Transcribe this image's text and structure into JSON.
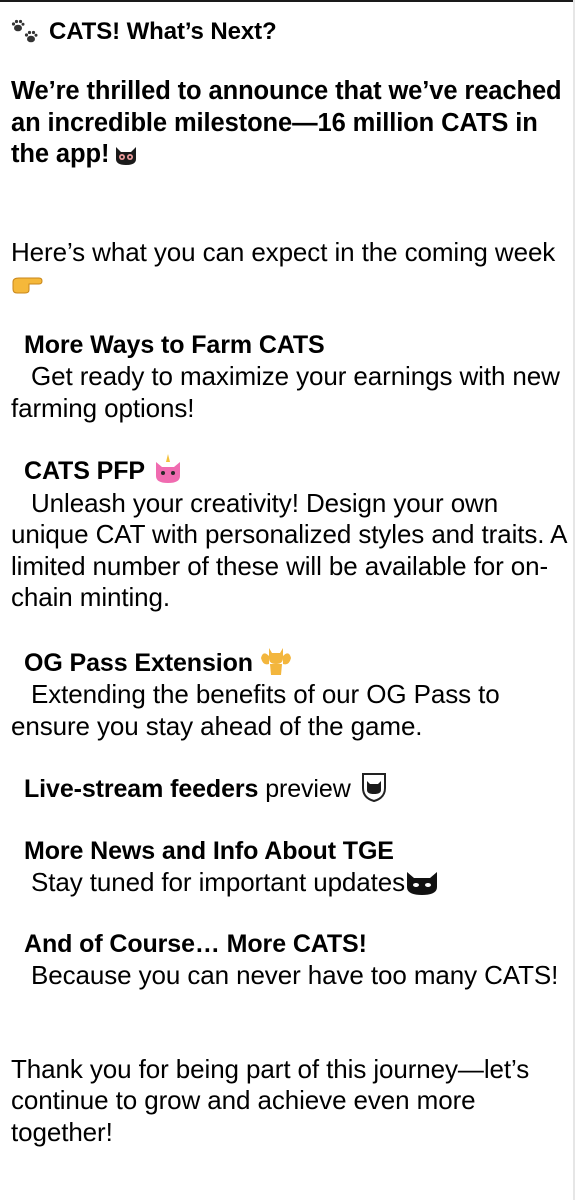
{
  "post": {
    "title": "CATS! What’s Next?",
    "announcement": "We’re thrilled to announce that we’ve reached an incredible milestone—16 million CATS in the app!",
    "intro": "Here’s what you can expect in the coming week",
    "sections": [
      {
        "heading": "More Ways to Farm CATS",
        "body": "Get ready to maximize your earnings with new farming options!"
      },
      {
        "heading": "CATS PFP",
        "body": "Unleash your creativity! Design your own unique CAT with personalized styles and traits. A limited number of these will be available for on-chain minting."
      },
      {
        "heading": "OG Pass Extension",
        "body": "Extending the benefits of our OG Pass to ensure you stay ahead of the game."
      },
      {
        "heading": "Live-stream feeders",
        "heading_suffix": "preview"
      },
      {
        "heading": "More News and Info About TGE",
        "body": "Stay tuned for important updates"
      },
      {
        "heading": "And of Course… More CATS!",
        "body": "Because you can never have too many CATS!"
      }
    ],
    "closing": "Thank you for being part of this journey—let’s continue to grow and achieve even more together!"
  },
  "icons": {
    "title": "paw-prints-icon",
    "announcement": "cat-face-icon",
    "intro": "pointing-hand-icon",
    "pfp": "pink-cat-unicorn-icon",
    "og_pass": "flexing-cat-icon",
    "live_stream": "cat-shield-icon",
    "tge": "black-cat-icon"
  }
}
